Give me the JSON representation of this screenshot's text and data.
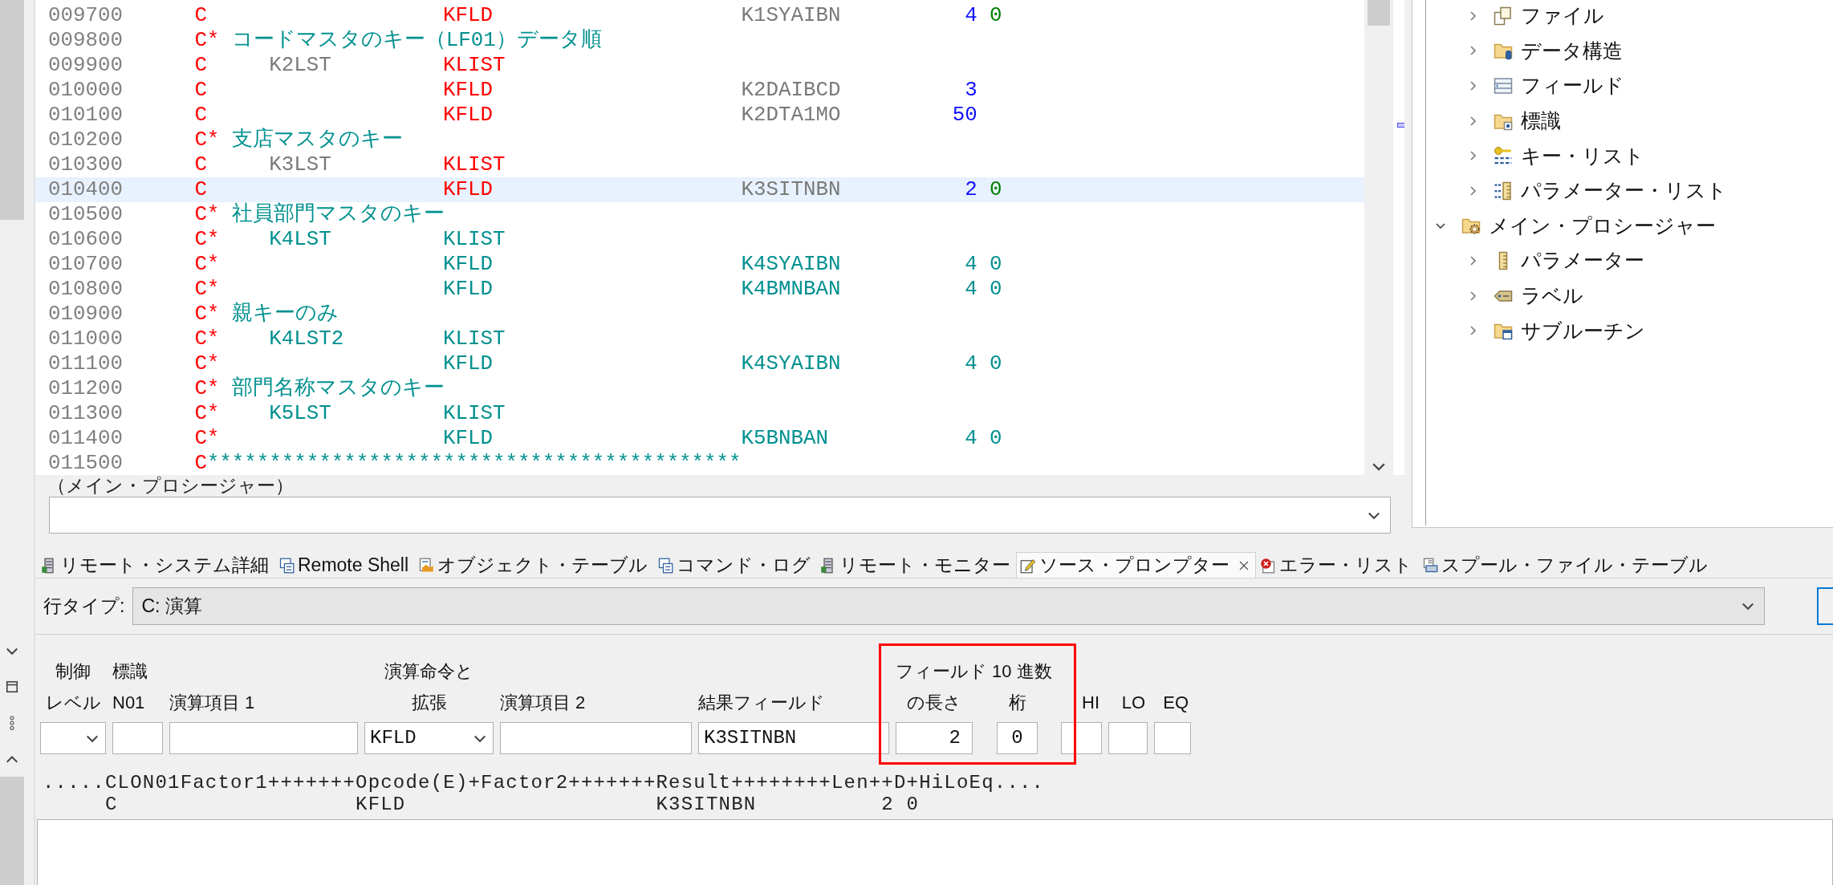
{
  "editor": {
    "rows": [
      {
        "line": "009700",
        "kind": "spec",
        "spec": "C",
        "opcode": "KFLD",
        "result": "K1SYAIBN",
        "length": "4",
        "decimals": "0",
        "selected": false
      },
      {
        "line": "009800",
        "kind": "comment",
        "spec": "C*",
        "text": "コードマスタのキー（LF01）データ順",
        "selected": false
      },
      {
        "line": "009900",
        "kind": "spec",
        "spec": "C",
        "factor1": "K2LST",
        "opcode": "KLIST",
        "selected": false
      },
      {
        "line": "010000",
        "kind": "spec",
        "spec": "C",
        "opcode": "KFLD",
        "result": "K2DAIBCD",
        "length": "3",
        "selected": false
      },
      {
        "line": "010100",
        "kind": "spec",
        "spec": "C",
        "opcode": "KFLD",
        "result": "K2DTA1MO",
        "length": "50",
        "selected": false
      },
      {
        "line": "010200",
        "kind": "comment",
        "spec": "C*",
        "text": "支店マスタのキー",
        "selected": false
      },
      {
        "line": "010300",
        "kind": "spec",
        "spec": "C",
        "factor1": "K3LST",
        "opcode": "KLIST",
        "selected": false
      },
      {
        "line": "010400",
        "kind": "spec",
        "spec": "C",
        "opcode": "KFLD",
        "result": "K3SITNBN",
        "length": "2",
        "decimals": "0",
        "selected": true
      },
      {
        "line": "010500",
        "kind": "comment",
        "spec": "C*",
        "text": "社員部門マスタのキー",
        "selected": false
      },
      {
        "line": "010600",
        "kind": "commented_spec",
        "spec": "C*",
        "factor1": "K4LST",
        "opcode": "KLIST",
        "selected": false
      },
      {
        "line": "010700",
        "kind": "commented_spec",
        "spec": "C*",
        "opcode": "KFLD",
        "result": "K4SYAIBN",
        "length": "4",
        "decimals": "0",
        "selected": false
      },
      {
        "line": "010800",
        "kind": "commented_spec",
        "spec": "C*",
        "opcode": "KFLD",
        "result": "K4BMNBAN",
        "length": "4",
        "decimals": "0",
        "selected": false
      },
      {
        "line": "010900",
        "kind": "comment",
        "spec": "C*",
        "text": "親キーのみ",
        "selected": false
      },
      {
        "line": "011000",
        "kind": "commented_spec",
        "spec": "C*",
        "factor1": "K4LST2",
        "opcode": "KLIST",
        "selected": false
      },
      {
        "line": "011100",
        "kind": "commented_spec",
        "spec": "C*",
        "opcode": "KFLD",
        "result": "K4SYAIBN",
        "length": "4",
        "decimals": "0",
        "selected": false
      },
      {
        "line": "011200",
        "kind": "comment",
        "spec": "C*",
        "text": "部門名称マスタのキー",
        "selected": false
      },
      {
        "line": "011300",
        "kind": "commented_spec",
        "spec": "C*",
        "factor1": "K5LST",
        "opcode": "KLIST",
        "selected": false
      },
      {
        "line": "011400",
        "kind": "commented_spec",
        "spec": "C*",
        "opcode": "KFLD",
        "result": "K5BNBAN",
        "length": "4",
        "decimals": "0",
        "selected": false
      },
      {
        "line": "011500",
        "kind": "separator",
        "spec": "C",
        "text": "*******************************************",
        "selected": false
      }
    ],
    "procedure_label": "（メイン・プロシージャー）"
  },
  "outline": [
    {
      "children": [
        {
          "label": "ファイル",
          "expanded": false
        },
        {
          "label": "データ構造",
          "expanded": false
        },
        {
          "label": "フィールド",
          "expanded": false
        },
        {
          "label": "標識",
          "expanded": false
        },
        {
          "label": "キー・リスト",
          "expanded": false
        },
        {
          "label": "パラメーター・リスト",
          "expanded": false
        }
      ]
    },
    {
      "label": "メイン・プロシージャー",
      "expanded": true,
      "children": [
        {
          "label": "パラメーター",
          "expanded": false
        },
        {
          "label": "ラベル",
          "expanded": false
        },
        {
          "label": "サブルーチン",
          "expanded": false
        }
      ]
    }
  ],
  "tabs": [
    {
      "label": "リモート・システム詳細",
      "selected": false,
      "closable": false
    },
    {
      "label": "Remote Shell",
      "selected": false,
      "closable": false
    },
    {
      "label": "オブジェクト・テーブル",
      "selected": false,
      "closable": false
    },
    {
      "label": "コマンド・ログ",
      "selected": false,
      "closable": false
    },
    {
      "label": "リモート・モニター",
      "selected": false,
      "closable": false
    },
    {
      "label": "ソース・プロンプター",
      "selected": true,
      "closable": true
    },
    {
      "label": "エラー・リスト",
      "selected": false,
      "closable": false
    },
    {
      "label": "スプール・ファイル・テーブル",
      "selected": false,
      "closable": false
    }
  ],
  "prompter": {
    "line_type_label": "行タイプ:",
    "line_type": "C: 演算",
    "group_heading": "フィールド 10 進数",
    "fields": [
      {
        "kind": "combo",
        "heading": [
          "制御",
          "レベル"
        ]
      },
      {
        "kind": "text",
        "heading": [
          "標識",
          "N01"
        ]
      },
      {
        "kind": "text",
        "heading": [
          "演算項目 1"
        ]
      },
      {
        "kind": "combo",
        "heading": [
          "演算命令と",
          "拡張"
        ],
        "value": "KFLD"
      },
      {
        "kind": "text",
        "heading": [
          "演算項目 2"
        ]
      },
      {
        "kind": "text",
        "heading": [
          "結果フィールド"
        ],
        "value": "K3SITNBN"
      },
      {
        "kind": "length",
        "heading": [
          "の長さ"
        ],
        "value": "2"
      },
      {
        "kind": "decimals",
        "heading": [
          "桁"
        ],
        "value": "0"
      },
      {
        "kind": "indicator",
        "heading": [
          "HI"
        ]
      },
      {
        "kind": "indicator",
        "heading": [
          "LO"
        ]
      },
      {
        "kind": "indicator",
        "heading": [
          "EQ"
        ]
      }
    ],
    "ruler": ".....CLON01Factor1+++++++Opcode(E)+Factor2+++++++Result++++++++Len++D+HiLoEq....",
    "source_preview": "     C                   KFLD                    K3SITNBN          2 0"
  }
}
